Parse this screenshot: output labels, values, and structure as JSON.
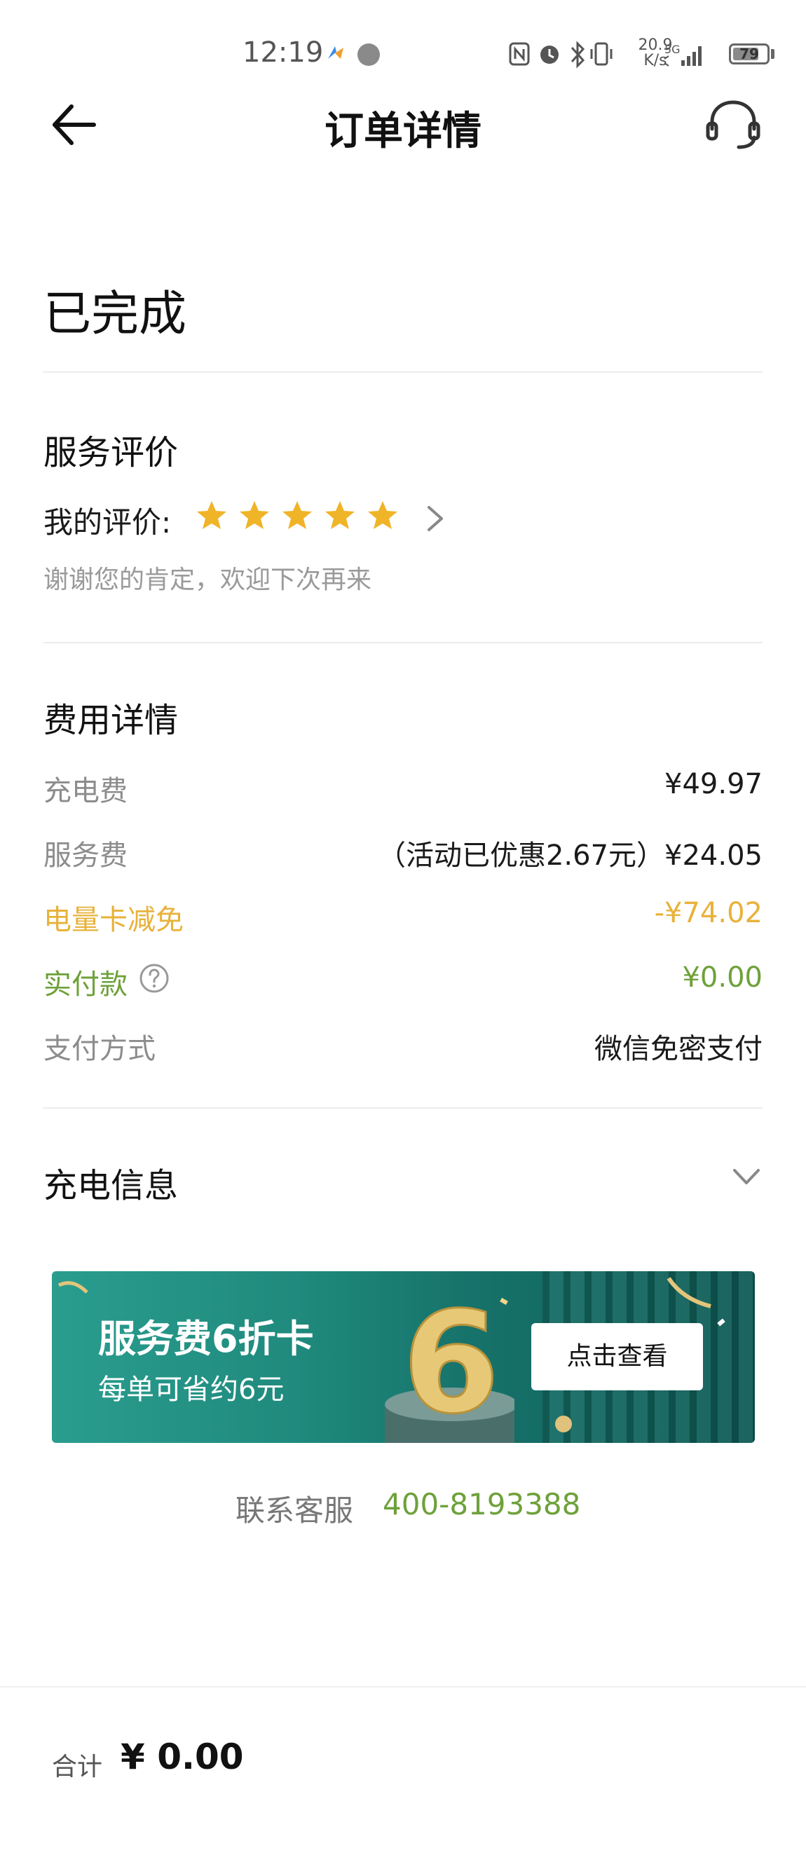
{
  "status_bar": {
    "time": "12:19",
    "net_speed_value": "20.9",
    "net_speed_unit": "K/s",
    "signal_type": "5G",
    "battery": "79",
    "battery_level": 0.79
  },
  "header": {
    "title": "订单详情",
    "back_icon": "arrow-left-icon",
    "service_icon": "headset-icon"
  },
  "order": {
    "status": "已完成"
  },
  "rating": {
    "section_title": "服务评价",
    "label": "我的评价:",
    "stars": 5,
    "star_color": "#f0b429",
    "note": "谢谢您的肯定，欢迎下次再来"
  },
  "fees": {
    "section_title": "费用详情",
    "rows": [
      {
        "label": "充电费",
        "value": "¥49.97"
      },
      {
        "label": "服务费",
        "value": "（活动已优惠2.67元）¥24.05"
      },
      {
        "label": "电量卡减免",
        "value": "-¥74.02"
      },
      {
        "label": "实付款",
        "value": "¥0.00"
      },
      {
        "label": "支付方式",
        "value": "微信免密支付"
      }
    ],
    "accent_orange": "#e8b23a",
    "accent_green": "#6ea13a"
  },
  "charging_info": {
    "title": "充电信息"
  },
  "banner": {
    "title": "服务费6折卡",
    "subtitle": "每单可省约6元",
    "big_number": "6",
    "button": "点击查看"
  },
  "contact": {
    "label": "联系客服",
    "phone": "400-8193388"
  },
  "footer": {
    "total_label": "合计",
    "total_value": "¥ 0.00"
  }
}
